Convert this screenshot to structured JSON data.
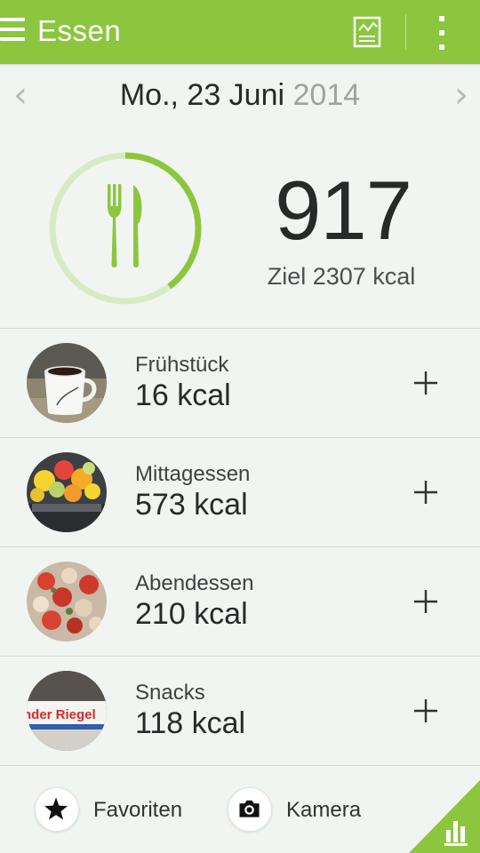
{
  "app": {
    "title": "Essen"
  },
  "date": {
    "main": "Mo., 23 Juni",
    "year": "2014"
  },
  "summary": {
    "consumed": "917",
    "goal_text": "Ziel 2307 kcal",
    "progress_fraction": 0.397
  },
  "meals": [
    {
      "name": "Frühstück",
      "kcal": "16 kcal",
      "photo": "coffee-cup"
    },
    {
      "name": "Mittagessen",
      "kcal": "573 kcal",
      "photo": "fruit-salad"
    },
    {
      "name": "Abendessen",
      "kcal": "210 kcal",
      "photo": "tomato-salad"
    },
    {
      "name": "Snacks",
      "kcal": "118 kcal",
      "photo": "chocolate-bar",
      "photo_text": "nder Riegel"
    }
  ],
  "bottom": {
    "favorites_label": "Favoriten",
    "camera_label": "Kamera"
  },
  "colors": {
    "accent": "#8cc63f",
    "ring_track": "#d7ebc3",
    "background": "#f1f5f2"
  },
  "icons": {
    "menu": "hamburger-icon",
    "chart": "chart-icon",
    "more": "more-vert-icon",
    "prev": "chevron-left-icon",
    "next": "chevron-right-icon",
    "summary": "fork-knife-icon",
    "add": "plus-icon",
    "favorites": "star-icon",
    "camera": "camera-icon",
    "stats": "bar-chart-icon"
  }
}
